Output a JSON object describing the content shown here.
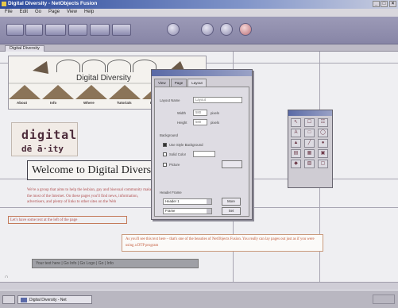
{
  "window": {
    "title": "Digital Diversity - NetObjects Fusion"
  },
  "menu": [
    "File",
    "Edit",
    "Go",
    "Page",
    "View",
    "Help"
  ],
  "doc_tab": "Digital Diversity",
  "banner": {
    "title": "Digital Diversity",
    "nav": [
      "About",
      "Info",
      "Where",
      "Tutorials",
      "Fu"
    ]
  },
  "logo": {
    "line1": "digital",
    "line2": "dē ā·ity"
  },
  "welcome": "Welcome to Digital Diversity",
  "intro": "We're a group that aims to help the lesbian, gay and bisexual community make the most of the Internet. On these pages you'll find news, information, advertisers, and plenty of links to other sites on the Web",
  "left_note": "Let's have some text at the left of the page",
  "mid_note": "As you'll see this text here – that's one of the beauties of NetObjects Fusion. You really can lay pages out just as if you were using a DTP program",
  "bottom_bar": "Your text here | Go Info | Go Logo | Go | Info",
  "dialog": {
    "tabs": [
      "View",
      "Page",
      "Layout"
    ],
    "layout_name_label": "Layout Name",
    "layout_name_value": "Layout",
    "width_label": "Width",
    "width_value": "580",
    "height_label": "Height",
    "height_value": "580",
    "unit": "pixels",
    "background_label": "Background",
    "opt_style": "Use Style Background",
    "opt_color": "Solid Color",
    "opt_picture": "Picture",
    "frames_label": "Header Frame",
    "frame1": "Header 1",
    "frame2": "Frame",
    "btn_more": "More",
    "btn_set": "Set"
  },
  "palette": {
    "tools": [
      "↖",
      "☐",
      "☷",
      "A",
      "□",
      "◯",
      "▲",
      "╱",
      "●",
      "▤",
      "▦",
      "▣",
      "◆",
      "▧",
      "▢"
    ]
  },
  "status_text": "",
  "cursor_text": "∩",
  "taskbar": {
    "start": "Start",
    "item": "Digital Diversity - Net",
    "tray": ""
  },
  "colors": {
    "accent": "#2c4a9c",
    "toolbar": "#8785a6",
    "page_bg": "#efeff2",
    "text_red": "#b14e4e"
  }
}
